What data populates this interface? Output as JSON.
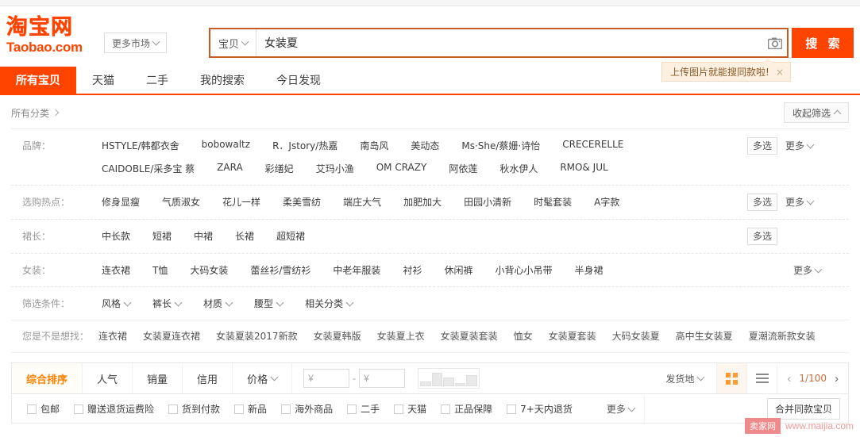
{
  "header": {
    "logo_cn": "淘宝网",
    "logo_en": "Taobao.com",
    "market_button": "更多市场",
    "search_scope": "宝贝",
    "search_value": "女装夏",
    "search_placeholder": "",
    "search_button": "搜 索",
    "camera_icon": "camera-icon",
    "tooltip_text": "上传图片就能搜同款啦!",
    "tooltip_close": "×",
    "accent_color": "#ff4400",
    "search_border_color": "#c85a23"
  },
  "nav_tabs": [
    {
      "label": "所有宝贝",
      "active": true
    },
    {
      "label": "天猫",
      "active": false
    },
    {
      "label": "二手",
      "active": false
    },
    {
      "label": "我的搜索",
      "active": false
    },
    {
      "label": "今日发现",
      "active": false
    }
  ],
  "category_bar": {
    "all_categories": "所有分类",
    "collapse_label": "收起筛选"
  },
  "filter_rows": [
    {
      "label": "品牌：",
      "values": [
        "HSTYLE/韩都衣舍",
        "bobowaltz",
        "R．Jstory/热嘉",
        "南岛风",
        "美动态",
        "Ms·She/蔡姗·诗怡",
        "CRECERELLE",
        "CAIDOBLE/采多宝 蔡",
        "ZARA",
        "彩缮妃",
        "艾玛小渔",
        "OM CRAZY",
        "阿依莲",
        "秋水伊人",
        "RMO& JUL"
      ],
      "multi_label": "多选",
      "more_label": "更多",
      "has_multi": true,
      "has_more": true
    },
    {
      "label": "选购热点：",
      "values": [
        "修身显瘦",
        "气质淑女",
        "花儿一样",
        "柔美雪纺",
        "端庄大气",
        "加肥加大",
        "田园小清新",
        "时髦套装",
        "A字款"
      ],
      "multi_label": "多选",
      "more_label": "更多",
      "has_multi": true,
      "has_more": true
    },
    {
      "label": "裙长：",
      "values": [
        "中长款",
        "短裙",
        "中裙",
        "长裙",
        "超短裙"
      ],
      "multi_label": "多选",
      "more_label": "",
      "has_multi": true,
      "has_more": false
    },
    {
      "label": "女装：",
      "values": [
        "连衣裙",
        "T恤",
        "大码女装",
        "蕾丝衫/雪纺衫",
        "中老年服装",
        "衬衫",
        "休闲裤",
        "小背心小吊带",
        "半身裙"
      ],
      "multi_label": "",
      "more_label": "更多",
      "has_multi": false,
      "has_more": true
    },
    {
      "label": "筛选条件：",
      "values": [
        "风格",
        "裤长",
        "材质",
        "腰型",
        "相关分类"
      ],
      "multi_label": "",
      "more_label": "",
      "has_multi": false,
      "has_more": false,
      "dropdown": true
    }
  ],
  "suggestions": {
    "label": "您是不是想找：",
    "items": [
      "连衣裙",
      "女装夏连衣裙",
      "女装夏装2017新款",
      "女装夏韩版",
      "女装夏上衣",
      "女装夏装套装",
      "恤女",
      "女装夏套装",
      "大码女装夏",
      "高中生女装夏",
      "夏潮流新款女装"
    ]
  },
  "sort_bar": {
    "tabs": [
      {
        "label": "综合排序",
        "active": true,
        "dropdown": false
      },
      {
        "label": "人气",
        "active": false,
        "dropdown": false
      },
      {
        "label": "销量",
        "active": false,
        "dropdown": false
      },
      {
        "label": "信用",
        "active": false,
        "dropdown": false
      },
      {
        "label": "价格",
        "active": false,
        "dropdown": true
      }
    ],
    "price_min_symbol": "¥",
    "price_min_value": "",
    "price_max_symbol": "¥",
    "price_max_value": "",
    "price_separator": "-",
    "histogram_bars": [
      30,
      85,
      55,
      20,
      72
    ],
    "ship_from_label": "发货地",
    "grid_view_icon": "grid-view-icon",
    "list_view_icon": "list-view-icon",
    "prev_page": "‹",
    "next_page": "›",
    "page_indicator": "1/100"
  },
  "checkbox_row": {
    "items": [
      "包邮",
      "赠送退货运费险",
      "货到付款",
      "新品",
      "海外商品",
      "二手",
      "天猫",
      "正品保障",
      "7+天内退货"
    ],
    "more_label": "更多",
    "merge_button": "合并同款宝贝"
  },
  "watermark": {
    "tag": "卖家网",
    "url": "www.maijia.com"
  }
}
